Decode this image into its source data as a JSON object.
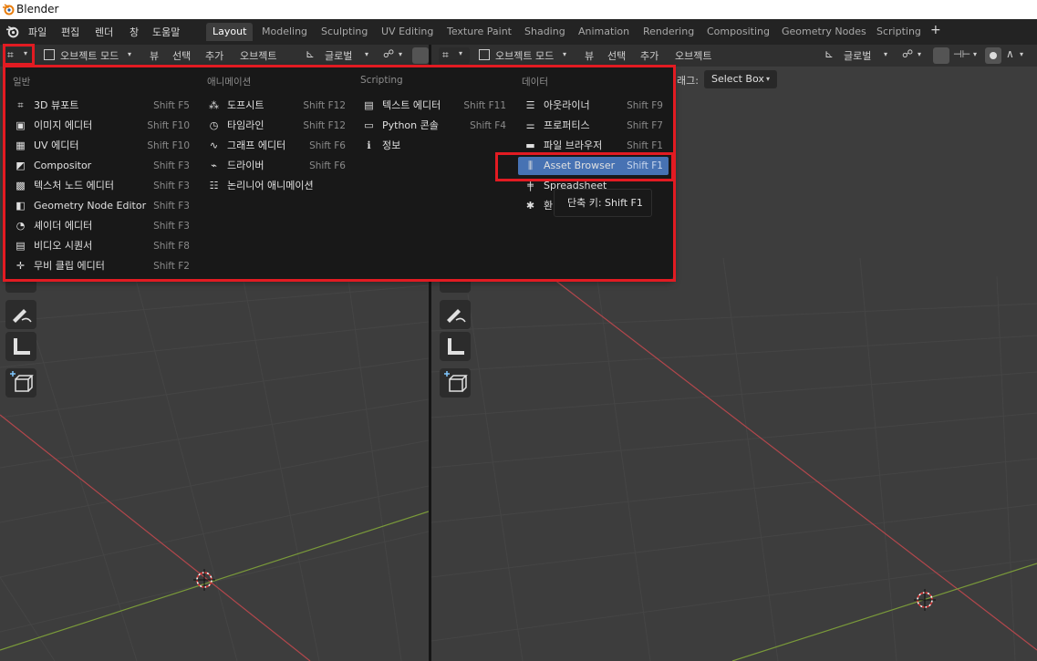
{
  "window": {
    "title": "Blender"
  },
  "menubar": {
    "file": "파일",
    "edit": "편집",
    "render": "렌더",
    "window": "창",
    "help": "도움말"
  },
  "workspaces": [
    "Layout",
    "Modeling",
    "Sculpting",
    "UV Editing",
    "Texture Paint",
    "Shading",
    "Animation",
    "Rendering",
    "Compositing",
    "Geometry Nodes",
    "Scripting"
  ],
  "add_workspace": "+",
  "left_header": {
    "mode": "오브젝트 모드",
    "view": "뷰",
    "select": "선택",
    "add": "추가",
    "object": "오브젝트",
    "transform": "글로벌"
  },
  "right_header": {
    "mode": "오브젝트 모드",
    "view": "뷰",
    "select": "선택",
    "add": "추가",
    "object": "오브젝트",
    "transform": "글로벌"
  },
  "tool_settings": {
    "drag_label": "래그:",
    "drag_value": "Select Box"
  },
  "editor_menu": {
    "columns": [
      {
        "title": "일반",
        "items": [
          {
            "label": "3D 뷰포트",
            "shortcut": "Shift F5",
            "icon": "3d-viewport-icon"
          },
          {
            "label": "이미지 에디터",
            "shortcut": "Shift F10",
            "icon": "image-editor-icon"
          },
          {
            "label": "UV 에디터",
            "shortcut": "Shift F10",
            "icon": "uv-editor-icon"
          },
          {
            "label": "Compositor",
            "shortcut": "Shift F3",
            "icon": "compositor-icon"
          },
          {
            "label": "텍스처 노드 에디터",
            "shortcut": "Shift F3",
            "icon": "texture-node-icon"
          },
          {
            "label": "Geometry Node Editor",
            "shortcut": "Shift F3",
            "icon": "geometry-node-icon"
          },
          {
            "label": "셰이더 에디터",
            "shortcut": "Shift F3",
            "icon": "shader-editor-icon"
          },
          {
            "label": "비디오 시퀀서",
            "shortcut": "Shift F8",
            "icon": "video-sequencer-icon"
          },
          {
            "label": "무비 클립 에디터",
            "shortcut": "Shift F2",
            "icon": "movie-clip-icon"
          }
        ]
      },
      {
        "title": "애니메이션",
        "items": [
          {
            "label": "도프시트",
            "shortcut": "Shift F12",
            "icon": "dopesheet-icon"
          },
          {
            "label": "타임라인",
            "shortcut": "Shift F12",
            "icon": "timeline-icon"
          },
          {
            "label": "그래프 에디터",
            "shortcut": "Shift F6",
            "icon": "graph-editor-icon"
          },
          {
            "label": "드라이버",
            "shortcut": "Shift F6",
            "icon": "drivers-icon"
          },
          {
            "label": "논리니어 애니메이션",
            "shortcut": "",
            "icon": "nla-icon"
          }
        ]
      },
      {
        "title": "Scripting",
        "items": [
          {
            "label": "텍스트 에디터",
            "shortcut": "Shift F11",
            "icon": "text-editor-icon"
          },
          {
            "label": "Python 콘솔",
            "shortcut": "Shift F4",
            "icon": "python-console-icon"
          },
          {
            "label": "정보",
            "shortcut": "",
            "icon": "info-icon"
          }
        ]
      },
      {
        "title": "데이터",
        "items": [
          {
            "label": "아웃라이너",
            "shortcut": "Shift F9",
            "icon": "outliner-icon"
          },
          {
            "label": "프로퍼티스",
            "shortcut": "Shift F7",
            "icon": "properties-icon"
          },
          {
            "label": "파일 브라우저",
            "shortcut": "Shift F1",
            "icon": "file-browser-icon"
          },
          {
            "label": "Asset Browser",
            "shortcut": "Shift F1",
            "icon": "asset-browser-icon",
            "highlighted": true
          },
          {
            "label": "Spreadsheet",
            "shortcut": "",
            "icon": "spreadsheet-icon"
          },
          {
            "label": "환",
            "shortcut": "",
            "icon": "preferences-icon"
          }
        ]
      }
    ]
  },
  "tooltip": {
    "text": "단축 키: Shift F1"
  },
  "colors": {
    "accent": "#4772b3",
    "highlight_frame": "#e21b22",
    "x_axis": "#b3474c",
    "y_axis": "#7a9a3a"
  }
}
